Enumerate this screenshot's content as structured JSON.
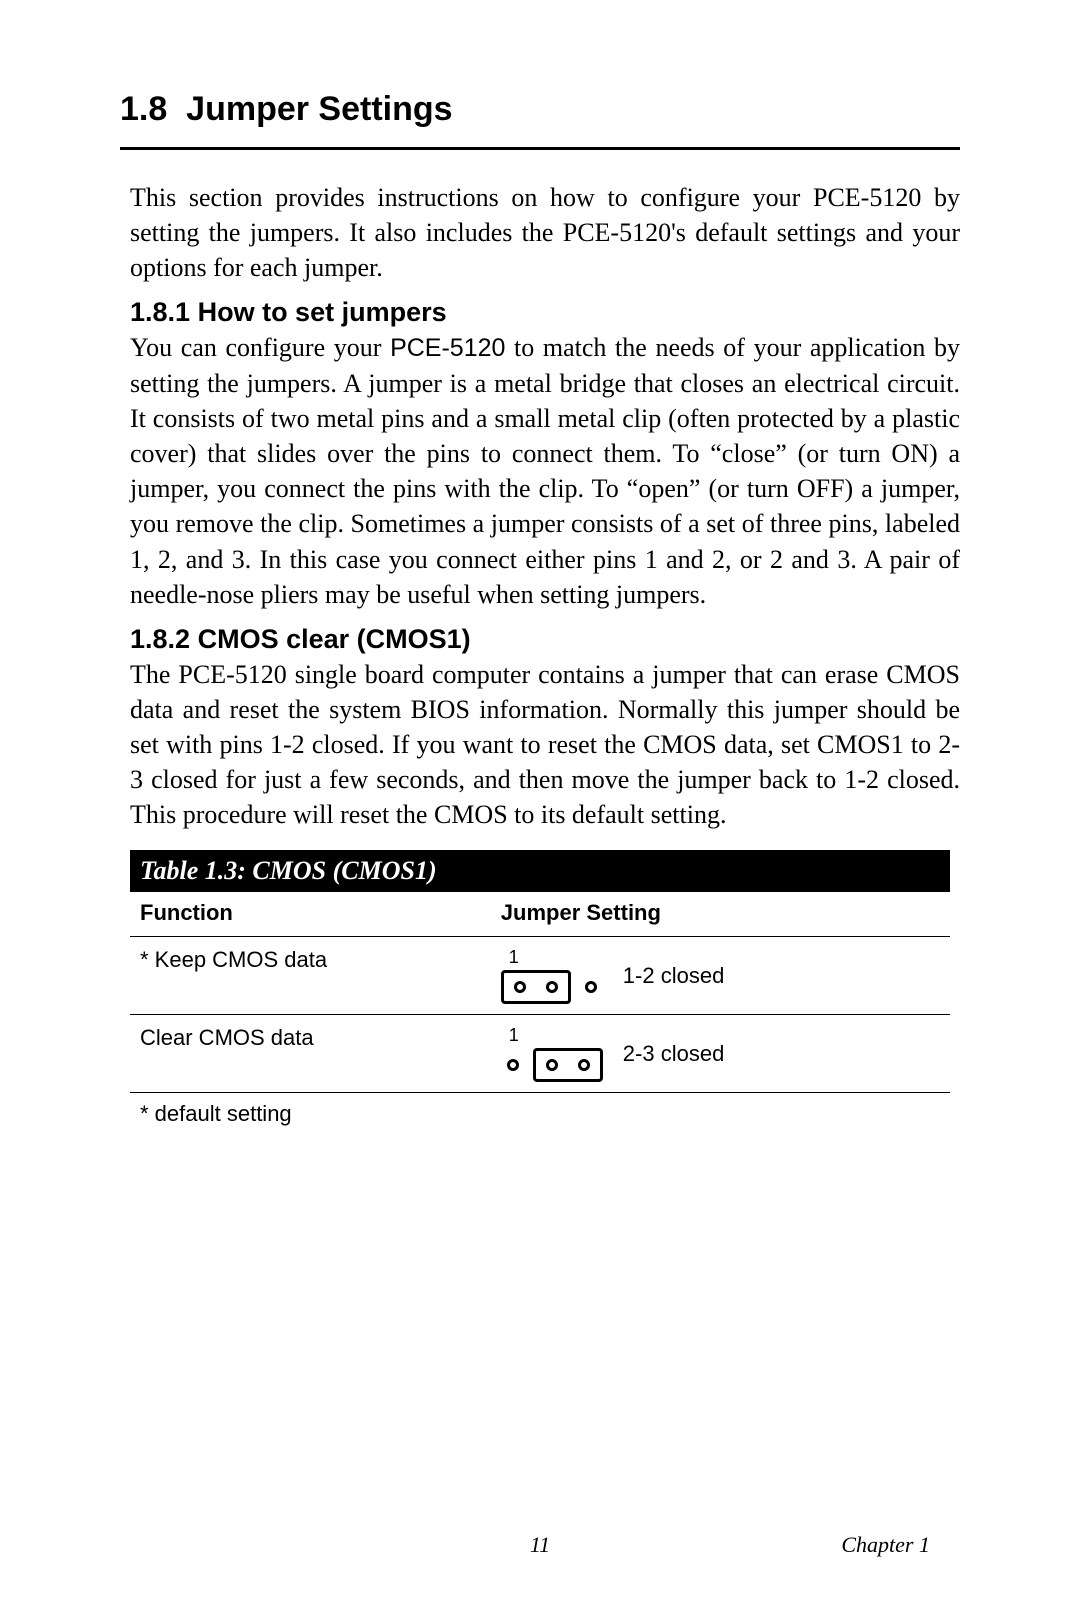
{
  "section": {
    "number": "1.8",
    "title": "Jumper Settings",
    "intro": "This section provides instructions on how to configure your PCE-5120 by setting the jumpers. It also includes the PCE-5120's default settings and your options for each jumper."
  },
  "sub1": {
    "number": "1.8.1",
    "title": "How to set jumpers",
    "prefix": "You can configure your ",
    "pce": "PCE-5120",
    "suffix": " to match the needs of your application by setting the jumpers. A jumper is a metal bridge that closes an electrical circuit. It consists of two metal pins and a small metal clip (often protected by a plastic cover) that slides over the pins to connect them. To “close” (or turn ON) a jumper, you connect the pins with the clip. To “open” (or turn OFF) a jumper, you remove the clip. Sometimes a jumper consists of a set of three pins, labeled 1, 2, and 3. In this case you connect either pins 1 and 2, or 2 and 3. A pair of needle-nose pliers may be useful when setting jumpers."
  },
  "sub2": {
    "number": "1.8.2",
    "title": "CMOS clear (CMOS1)",
    "text": "The PCE-5120 single board computer contains a jumper that can erase CMOS data and reset the system BIOS information. Normally this jumper should be set with pins 1-2 closed. If you want to reset the CMOS data, set CMOS1 to 2-3 closed for just a few seconds, and then move the jumper back to 1-2 closed. This procedure will reset the CMOS to its default setting."
  },
  "table": {
    "caption": "Table 1.3: CMOS (CMOS1)",
    "head": {
      "c1": "Function",
      "c2": "Jumper Setting"
    },
    "rows": [
      {
        "function": "* Keep CMOS data",
        "pin1_label": "1",
        "setting_label": "1-2 closed",
        "closed_pins": [
          1,
          2
        ]
      },
      {
        "function": "Clear CMOS data",
        "pin1_label": "1",
        "setting_label": "2-3 closed",
        "closed_pins": [
          2,
          3
        ]
      }
    ],
    "footnote": "* default setting"
  },
  "footer": {
    "page": "11",
    "chapter": "Chapter 1"
  }
}
